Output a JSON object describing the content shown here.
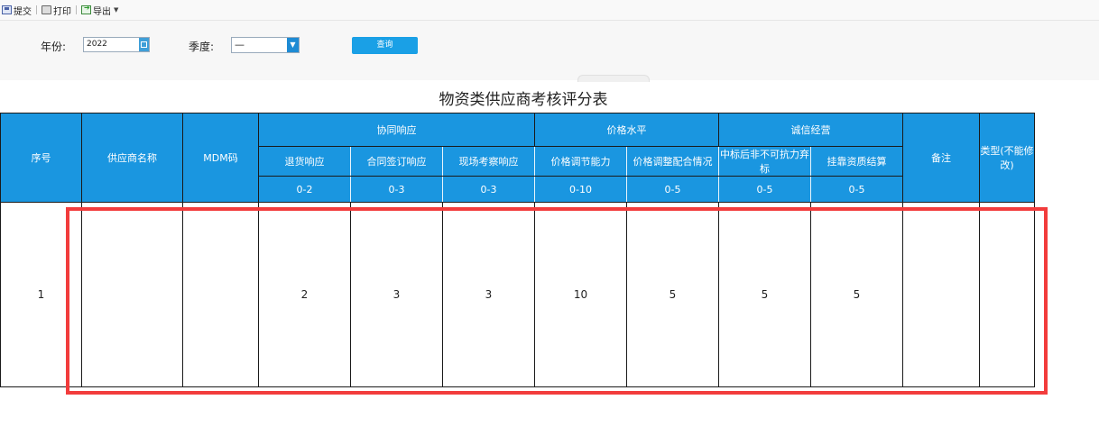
{
  "toolbar": {
    "submit": "提交",
    "print": "打印",
    "export": "导出"
  },
  "filter": {
    "year_label": "年份:",
    "year_value": "2022",
    "season_label": "季度:",
    "season_value": "—",
    "query_button": "查询"
  },
  "title": "物资类供应商考核评分表",
  "table": {
    "headers": {
      "seq": "序号",
      "supplier": "供应商名称",
      "mdm": "MDM码",
      "group1": "协同响应",
      "group2": "价格水平",
      "group3": "诚信经营",
      "remark": "备注",
      "type": "类型(不能修改)"
    },
    "subheaders": [
      "退货响应",
      "合同签订响应",
      "现场考察响应",
      "价格调节能力",
      "价格调整配合情况",
      "中标后非不可抗力弃标",
      "挂靠资质结算"
    ],
    "ranges": [
      "0-2",
      "0-3",
      "0-3",
      "0-10",
      "0-5",
      "0-5",
      "0-5"
    ],
    "rows": [
      {
        "seq": "1",
        "supplier": "",
        "mdm": "",
        "scores": [
          "2",
          "3",
          "3",
          "10",
          "5",
          "5",
          "5"
        ],
        "remark": "",
        "type": ""
      }
    ]
  }
}
